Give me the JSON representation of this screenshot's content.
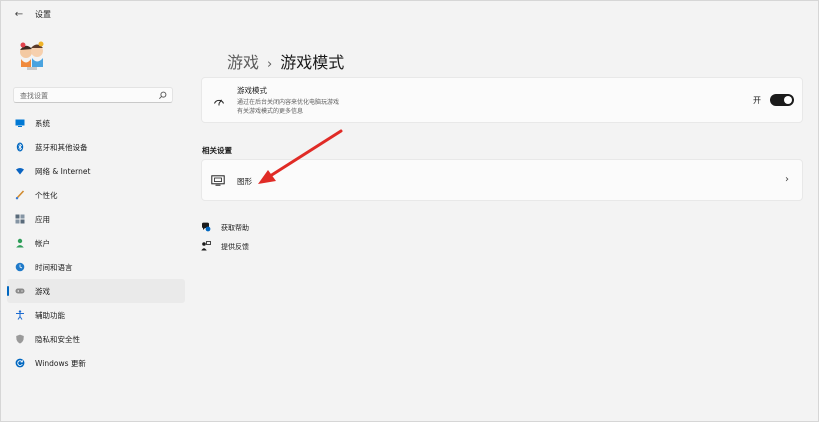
{
  "titlebar": {
    "back_icon": "back-arrow-icon",
    "title": "设置"
  },
  "search": {
    "placeholder": "查找设置",
    "icon": "search-icon"
  },
  "nav": {
    "items": [
      {
        "label": "系统",
        "icon": "monitor-icon",
        "color": "#0078d4"
      },
      {
        "label": "蓝牙和其他设备",
        "icon": "bluetooth-icon",
        "color": "#0067c0"
      },
      {
        "label": "网络 & Internet",
        "icon": "wifi-icon",
        "color": "#0a64c2"
      },
      {
        "label": "个性化",
        "icon": "brush-icon",
        "color": "#d08a2e"
      },
      {
        "label": "应用",
        "icon": "apps-icon",
        "color": "#5a6b7b"
      },
      {
        "label": "帐户",
        "icon": "person-icon",
        "color": "#2e9d59"
      },
      {
        "label": "时间和语言",
        "icon": "globe-clock-icon",
        "color": "#1f7ac9"
      },
      {
        "label": "游戏",
        "icon": "gamepad-icon",
        "color": "#7a7a7a",
        "selected": true
      },
      {
        "label": "辅助功能",
        "icon": "accessibility-icon",
        "color": "#1d6bd0"
      },
      {
        "label": "隐私和安全性",
        "icon": "shield-icon",
        "color": "#8a8a8a"
      },
      {
        "label": "Windows 更新",
        "icon": "update-icon",
        "color": "#0067c0"
      }
    ]
  },
  "breadcrumb": {
    "parent": "游戏",
    "separator": "›",
    "current": "游戏模式"
  },
  "game_mode": {
    "title": "游戏模式",
    "desc_line1": "通过在后台关闭内容来优化电脑玩游戏",
    "desc_line2": "有关游戏模式的更多信息",
    "state_label": "开",
    "toggle_on": true,
    "icon": "speedometer-icon"
  },
  "related": {
    "section_title": "相关设置",
    "graphics_label": "图形",
    "graphics_icon": "display-icon",
    "chevron": "›"
  },
  "links": [
    {
      "label": "获取帮助",
      "icon": "help-icon"
    },
    {
      "label": "提供反馈",
      "icon": "feedback-icon"
    }
  ],
  "annotation_color": "#e02b26"
}
